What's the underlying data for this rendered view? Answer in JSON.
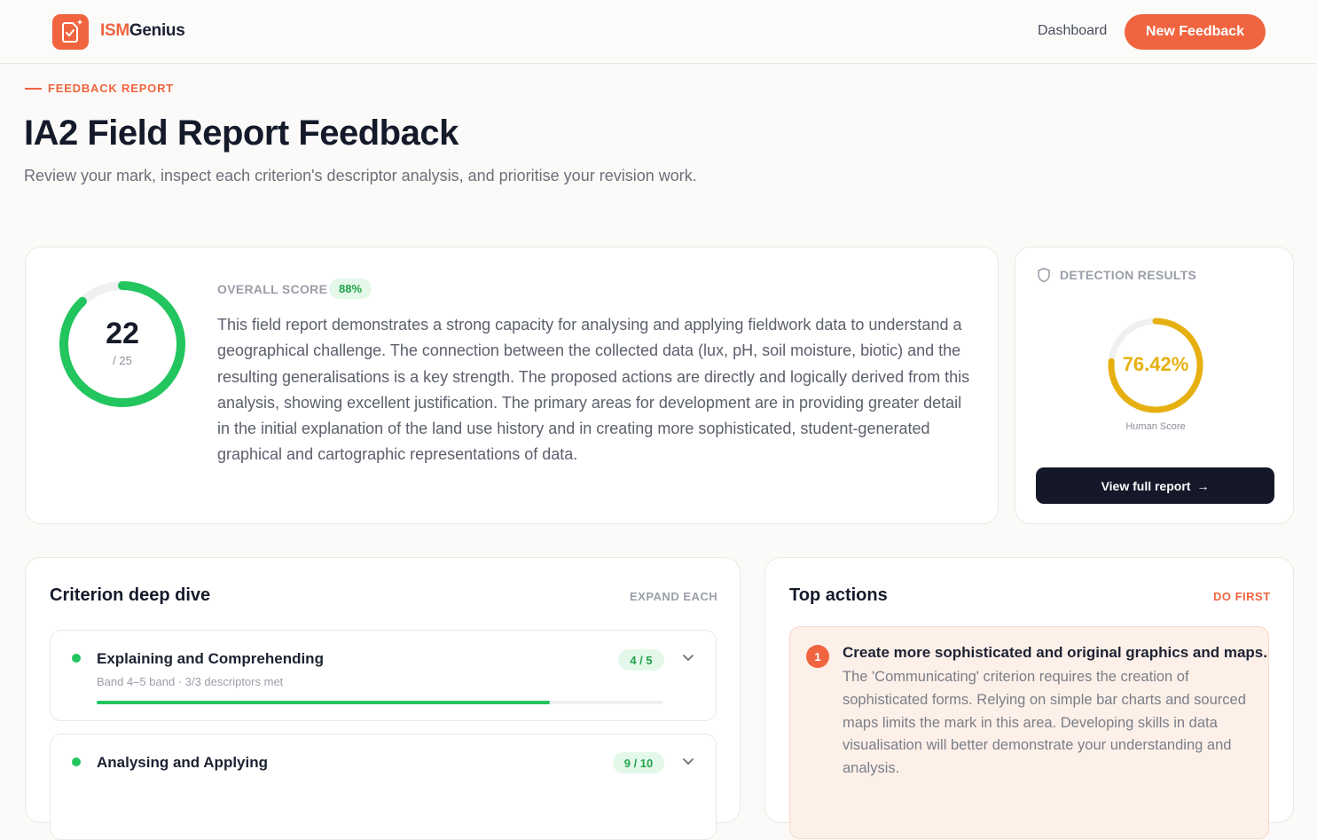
{
  "brand": {
    "prefix": "ISM",
    "suffix": "Genius",
    "accent": "#f06440"
  },
  "nav": {
    "dashboard_label": "Dashboard",
    "new_feedback_label": "New Feedback"
  },
  "header": {
    "eyebrow": "FEEDBACK REPORT",
    "title": "IA2 Field Report Feedback",
    "subtitle": "Review your mark, inspect each criterion's descriptor analysis, and prioritise your revision work."
  },
  "overall": {
    "score": "22",
    "denominator": "/ 25",
    "score_fraction": 0.88,
    "label": "OVERALL SCORE",
    "percent": "88%",
    "summary": "This field report demonstrates a strong capacity for analysing and applying fieldwork data to understand a geographical challenge. The connection between the collected data (lux, pH, soil moisture, biotic) and the resulting generalisations is a key strength. The proposed actions are directly and logically derived from this analysis, showing excellent justification. The primary areas for development are in providing greater detail in the initial explanation of the land use history and in creating more sophisticated, student-generated graphical and cartographic representations of data.",
    "color": "#22c55e"
  },
  "detection": {
    "label": "DETECTION RESULTS",
    "value": "76.42%",
    "value_fraction": 0.7642,
    "caption": "Human Score",
    "button_label": "View full report",
    "color": "#e6b010"
  },
  "criteria": {
    "title": "Criterion deep dive",
    "tag": "EXPAND EACH",
    "items": [
      {
        "name": "Explaining and Comprehending",
        "meta": "Band 4–5 band · 3/3 descriptors met",
        "score": "4 / 5",
        "progress": 0.8
      },
      {
        "name": "Analysing and Applying",
        "score": "9 / 10"
      }
    ]
  },
  "actions": {
    "title": "Top actions",
    "tag": "DO FIRST",
    "items": [
      {
        "number": "1",
        "title": "Create more sophisticated and original graphics and maps.",
        "text": "The 'Communicating' criterion requires the creation of sophisticated forms. Relying on simple bar charts and sourced maps limits the mark in this area. Developing skills in data visualisation will better demonstrate your understanding and analysis."
      }
    ]
  }
}
